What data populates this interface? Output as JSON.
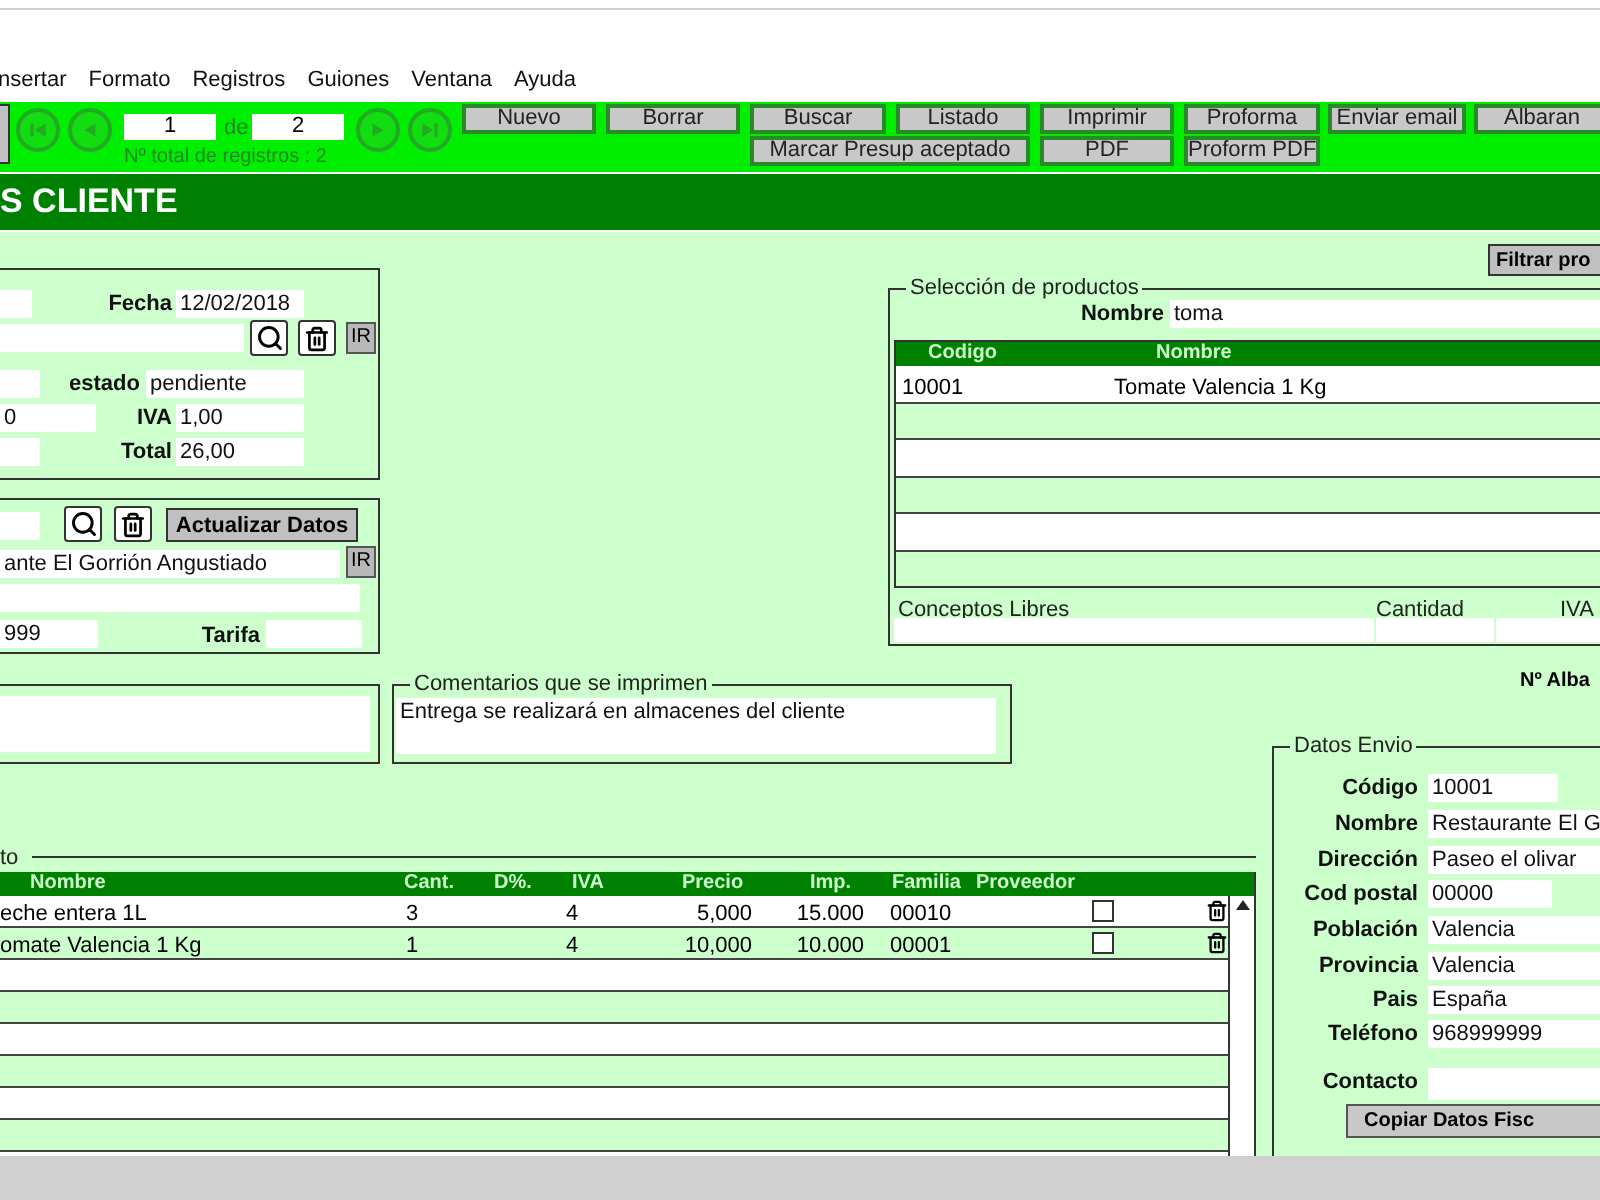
{
  "menu": [
    "nsertar",
    "Formato",
    "Registros",
    "Guiones",
    "Ventana",
    "Ayuda"
  ],
  "nav": {
    "current": "1",
    "of_label": "de",
    "total": "2",
    "count_text": "Nº total de registros : 2"
  },
  "toolbar_rows": [
    [
      "Nuevo",
      "Borrar",
      "Buscar",
      "Listado",
      "Imprimir",
      "Proforma",
      "Enviar email",
      "Albaran"
    ],
    [
      "Marcar Presup aceptado",
      "PDF",
      "Proform PDF"
    ]
  ],
  "title": "S CLIENTE",
  "header_panel": {
    "fecha_label": "Fecha",
    "fecha": "12/02/2018",
    "estado_label": "estado",
    "estado": "pendiente",
    "field_3": "0",
    "iva_label": "IVA",
    "iva": "1,00",
    "total_label": "Total",
    "total": "26,00",
    "ir": "IR"
  },
  "client_panel": {
    "update_button": "Actualizar Datos",
    "name": "ante El Gorrión Angustiado",
    "ir": "IR",
    "phone": "999",
    "tarifa_label": "Tarifa"
  },
  "comments": {
    "legend": "Comentarios que se imprimen",
    "text": "Entrega se realizará en almacenes del cliente"
  },
  "filter_button": "Filtrar pro",
  "product_selection": {
    "legend": "Selección de productos",
    "name_label": "Nombre",
    "name_value": "toma",
    "columns": [
      "Codigo",
      "Nombre"
    ],
    "rows": [
      [
        "10001",
        "Tomate Valencia 1 Kg"
      ]
    ],
    "free_label": "Conceptos Libres",
    "qty_label": "Cantidad",
    "iva_label": "IVA"
  },
  "albaran_label": "Nº Alba",
  "shipping": {
    "legend": "Datos Envio",
    "fields": [
      {
        "label": "Código",
        "value": "10001"
      },
      {
        "label": "Nombre",
        "value": "Restaurante El  G"
      },
      {
        "label": "Dirección",
        "value": "Paseo el olivar"
      },
      {
        "label": "Cod postal",
        "value": "00000"
      },
      {
        "label": "Población",
        "value": "Valencia"
      },
      {
        "label": "Provincia",
        "value": "Valencia"
      },
      {
        "label": "Pais",
        "value": "España"
      },
      {
        "label": "Teléfono",
        "value": "968999999"
      },
      {
        "label": "Contacto"
      }
    ],
    "copy_button": "Copiar Datos Fisc"
  },
  "lines": {
    "legend": "to",
    "columns": [
      "Nombre",
      "Cant.",
      "D%.",
      "IVA",
      "Precio",
      "Imp.",
      "Familia",
      "Proveedor"
    ],
    "rows": [
      {
        "nombre": "eche entera 1L",
        "cant": "3",
        "iva": "4",
        "precio": "5,000",
        "imp": "15.000",
        "familia": "00010",
        "checked": false
      },
      {
        "nombre": "omate Valencia 1 Kg",
        "cant": "1",
        "iva": "4",
        "precio": "10,000",
        "imp": "10.000",
        "familia": "00001",
        "checked": false
      }
    ]
  }
}
